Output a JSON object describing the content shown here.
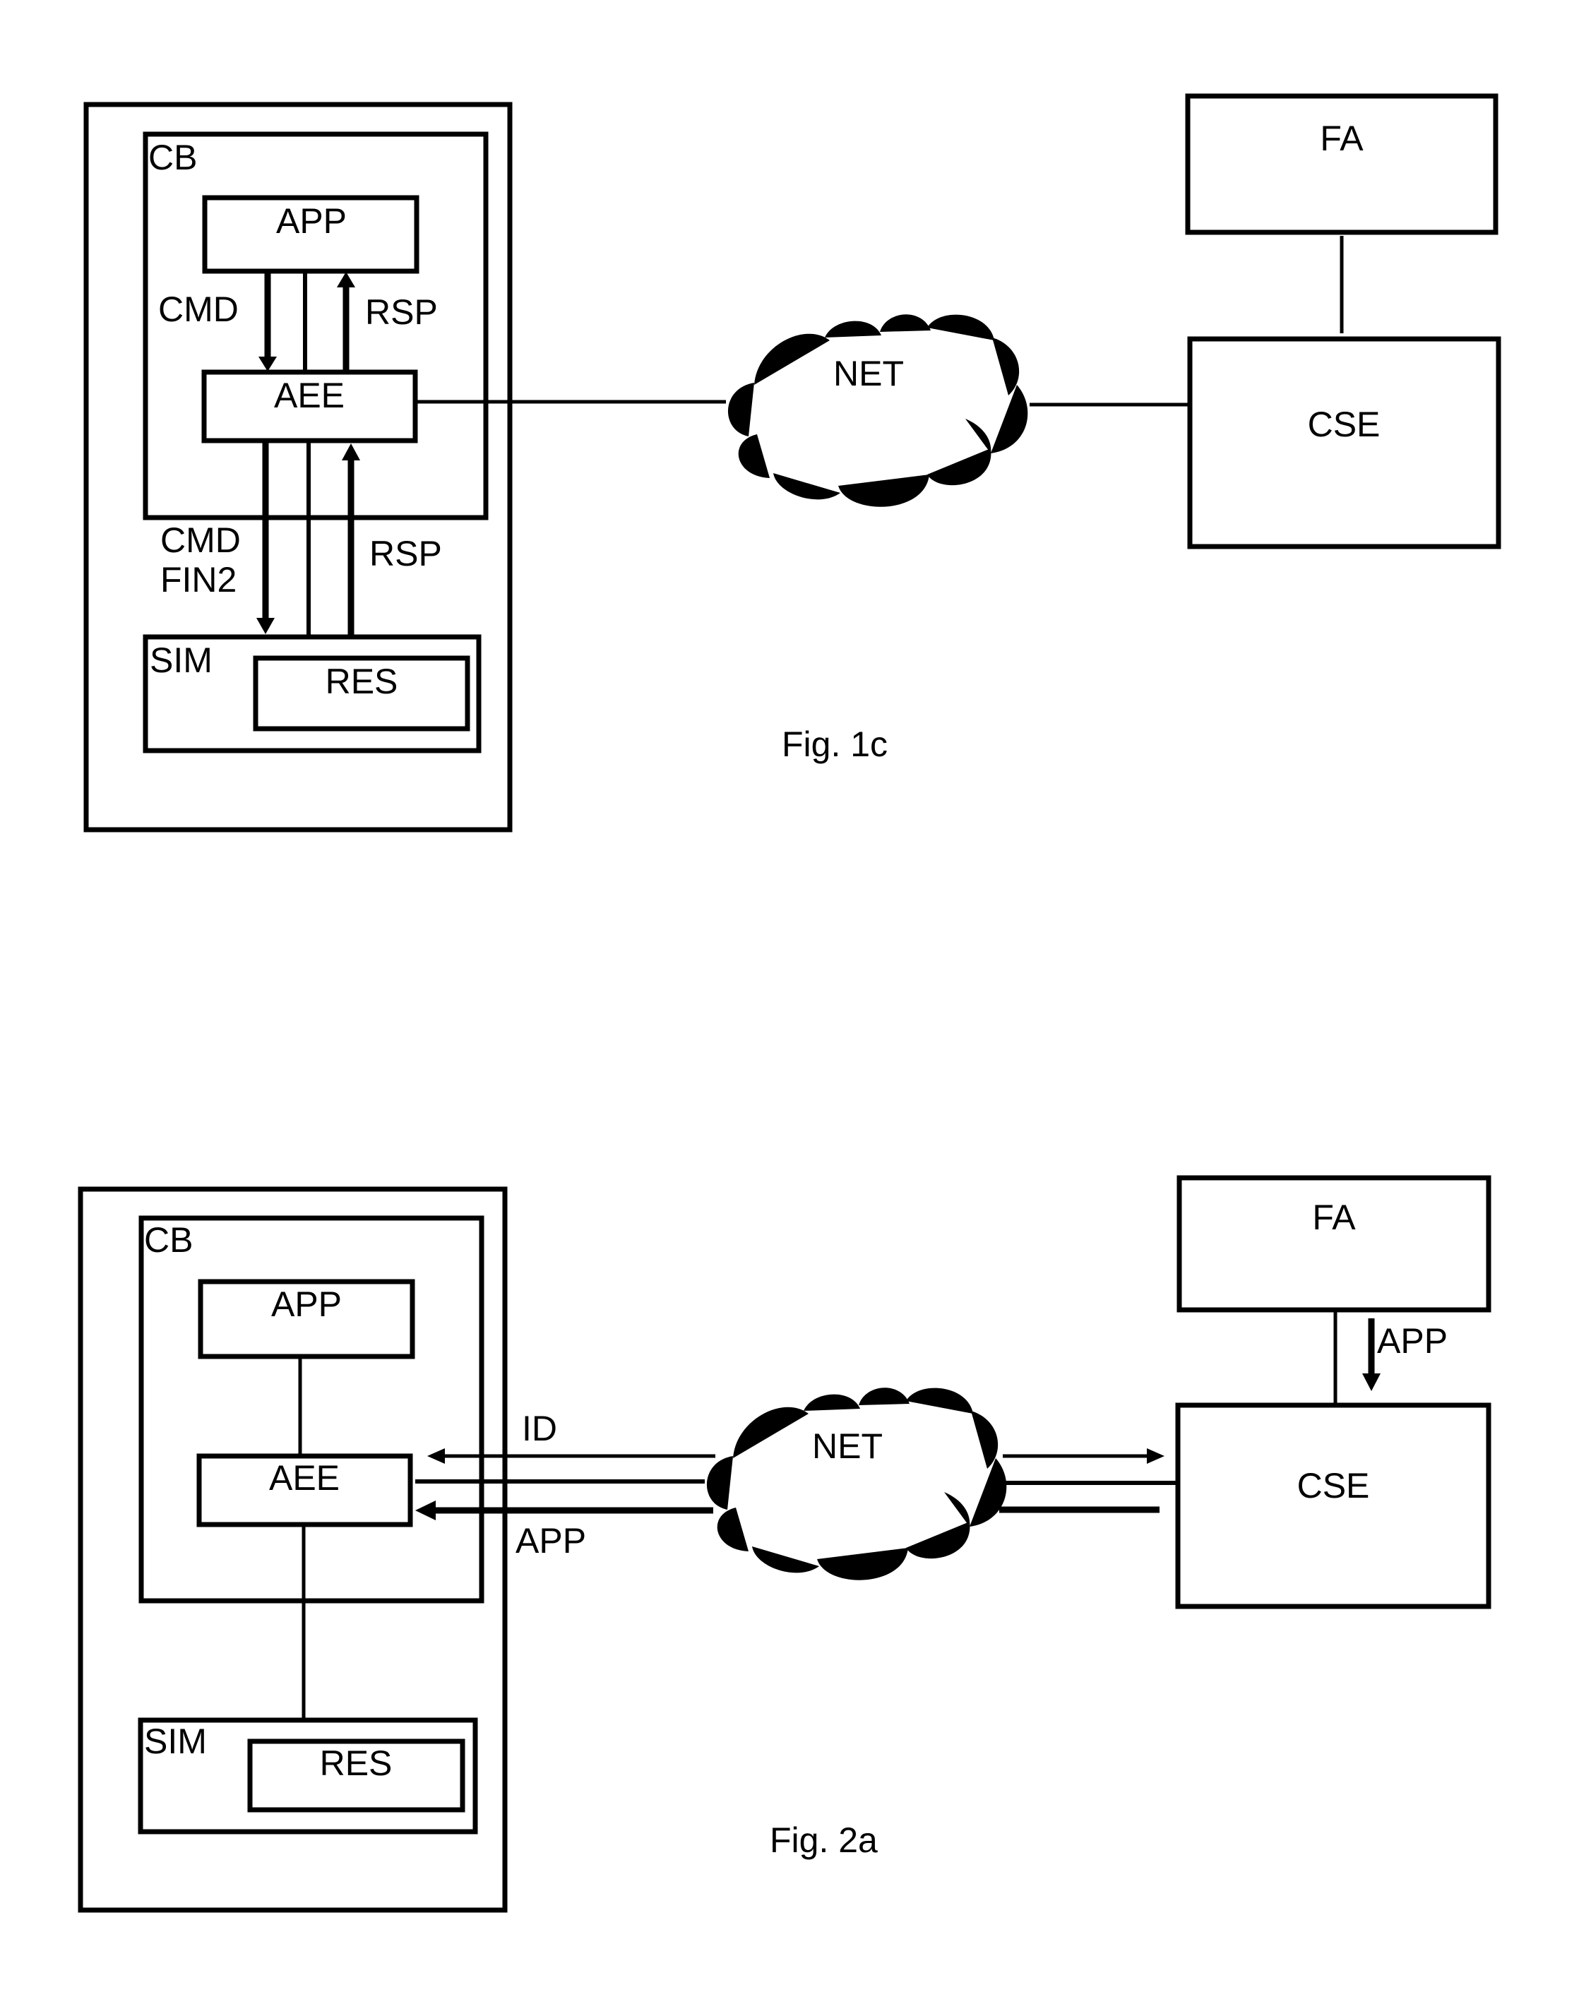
{
  "figures": [
    {
      "caption": "Fig. 1c",
      "device": {
        "cb_label": "CB",
        "app_label": "APP",
        "aee_label": "AEE",
        "sim_label": "SIM",
        "res_label": "RES",
        "upper_left_label": "CMD",
        "upper_right_label": "RSP",
        "lower_left_label_line1": "CMD",
        "lower_left_label_line2": "FIN2",
        "lower_right_label": "RSP"
      },
      "network_label": "NET",
      "server_label": "CSE",
      "fa_label": "FA"
    },
    {
      "caption": "Fig. 2a",
      "device": {
        "cb_label": "CB",
        "app_label": "APP",
        "aee_label": "AEE",
        "sim_label": "SIM",
        "res_label": "RES"
      },
      "link_labels": {
        "id": "ID",
        "app": "APP",
        "fa_to_cse": "APP"
      },
      "network_label": "NET",
      "server_label": "CSE",
      "fa_label": "FA"
    }
  ]
}
